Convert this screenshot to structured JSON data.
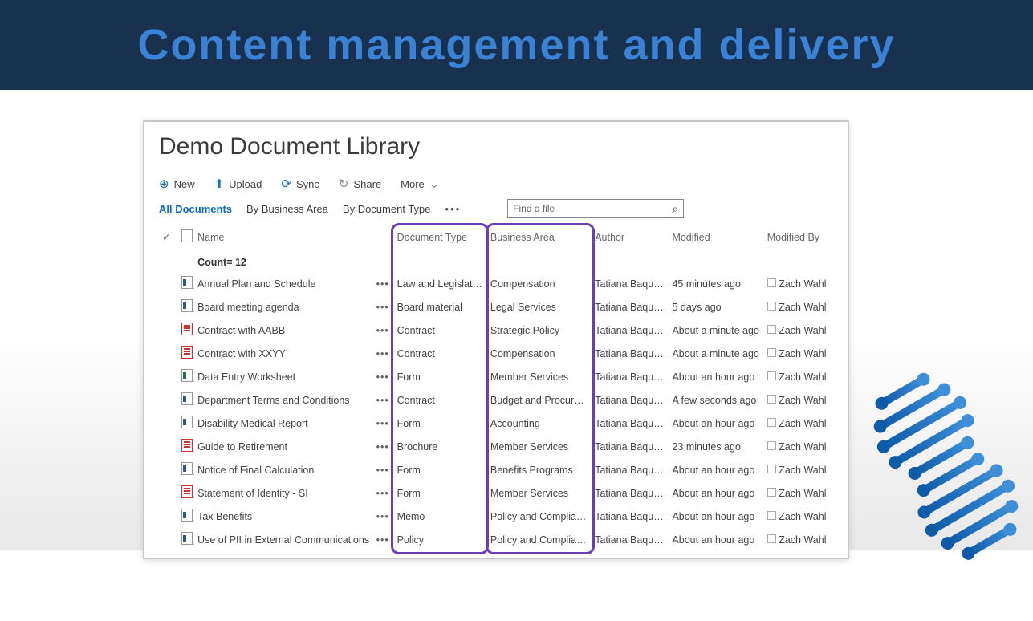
{
  "slide": {
    "title": "Content management and delivery"
  },
  "library": {
    "title": "Demo Document Library",
    "toolbar": {
      "new": "New",
      "upload": "Upload",
      "sync": "Sync",
      "share": "Share",
      "more": "More"
    },
    "views": {
      "all": "All Documents",
      "by_business_area": "By Business Area",
      "by_document_type": "By Document Type"
    },
    "search": {
      "placeholder": "Find a file"
    },
    "columns": {
      "name": "Name",
      "document_type": "Document Type",
      "business_area": "Business Area",
      "author": "Author",
      "modified": "Modified",
      "modified_by": "Modified By"
    },
    "count_label": "Count= 12",
    "rows": [
      {
        "icon": "word",
        "name": "Annual Plan and Schedule",
        "document_type": "Law and Legislation",
        "business_area": "Compensation",
        "author": "Tatiana Baquero",
        "modified": "45 minutes ago",
        "modified_by": "Zach Wahl"
      },
      {
        "icon": "word",
        "name": "Board meeting agenda",
        "document_type": "Board material",
        "business_area": "Legal Services",
        "author": "Tatiana Baquero",
        "modified": "5 days ago",
        "modified_by": "Zach Wahl"
      },
      {
        "icon": "pdf",
        "name": "Contract with AABB",
        "document_type": "Contract",
        "business_area": "Strategic Policy",
        "author": "Tatiana Baquero",
        "modified": "About a minute ago",
        "modified_by": "Zach Wahl"
      },
      {
        "icon": "pdf",
        "name": "Contract with XXYY",
        "document_type": "Contract",
        "business_area": "Compensation",
        "author": "Tatiana Baquero",
        "modified": "About a minute ago",
        "modified_by": "Zach Wahl"
      },
      {
        "icon": "xls",
        "name": "Data Entry Worksheet",
        "document_type": "Form",
        "business_area": "Member Services",
        "author": "Tatiana Baquero",
        "modified": "About an hour ago",
        "modified_by": "Zach Wahl"
      },
      {
        "icon": "word",
        "name": "Department Terms and Conditions",
        "document_type": "Contract",
        "business_area": "Budget and Procurement",
        "author": "Tatiana Baquero",
        "modified": "A few seconds ago",
        "modified_by": "Zach Wahl"
      },
      {
        "icon": "word",
        "name": "Disability Medical Report",
        "document_type": "Form",
        "business_area": "Accounting",
        "author": "Tatiana Baquero",
        "modified": "About an hour ago",
        "modified_by": "Zach Wahl"
      },
      {
        "icon": "pdf",
        "name": "Guide to Retirement",
        "document_type": "Brochure",
        "business_area": "Member Services",
        "author": "Tatiana Baquero",
        "modified": "23 minutes ago",
        "modified_by": "Zach Wahl"
      },
      {
        "icon": "word",
        "name": "Notice of Final Calculation",
        "document_type": "Form",
        "business_area": "Benefits Programs",
        "author": "Tatiana Baquero",
        "modified": "About an hour ago",
        "modified_by": "Zach Wahl"
      },
      {
        "icon": "pdf",
        "name": "Statement of Identity - SI",
        "document_type": "Form",
        "business_area": "Member Services",
        "author": "Tatiana Baquero",
        "modified": "About an hour ago",
        "modified_by": "Zach Wahl"
      },
      {
        "icon": "word",
        "name": "Tax Benefits",
        "document_type": "Memo",
        "business_area": "Policy and Compliance",
        "author": "Tatiana Baquero",
        "modified": "About an hour ago",
        "modified_by": "Zach Wahl"
      },
      {
        "icon": "word",
        "name": "Use of PII in External Communications",
        "document_type": "Policy",
        "business_area": "Policy and Compliance",
        "author": "Tatiana Baquero",
        "modified": "About an hour ago",
        "modified_by": "Zach Wahl"
      }
    ],
    "highlighted_columns": [
      "document_type",
      "business_area"
    ]
  }
}
